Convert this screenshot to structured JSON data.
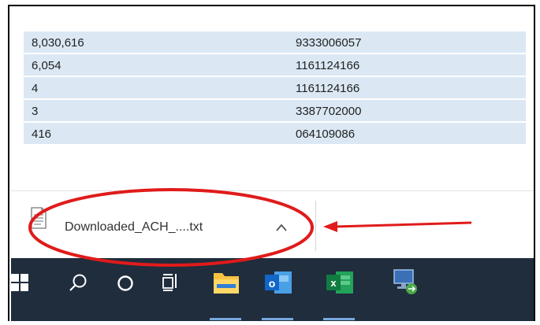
{
  "table": {
    "rows": [
      {
        "amount": "8,030,616",
        "account": "9333006057"
      },
      {
        "amount": "6,054",
        "account": "1161124166"
      },
      {
        "amount": "4",
        "account": "1161124166"
      },
      {
        "amount": "3",
        "account": "3387702000"
      },
      {
        "amount": "416",
        "account": "064109086"
      }
    ]
  },
  "download_bar": {
    "file_name": "Downloaded_ACH_....txt",
    "file_icon": "text-file-icon",
    "menu_icon": "chevron-up-icon"
  },
  "taskbar": {
    "icons": [
      "windows-start-icon",
      "search-icon",
      "cortana-icon",
      "task-view-icon",
      "file-explorer-icon",
      "outlook-icon",
      "excel-icon",
      "network-icon"
    ],
    "outlook_letter": "o",
    "excel_letter": "x"
  },
  "annotations": {
    "highlight_color": "#e01b1b"
  }
}
